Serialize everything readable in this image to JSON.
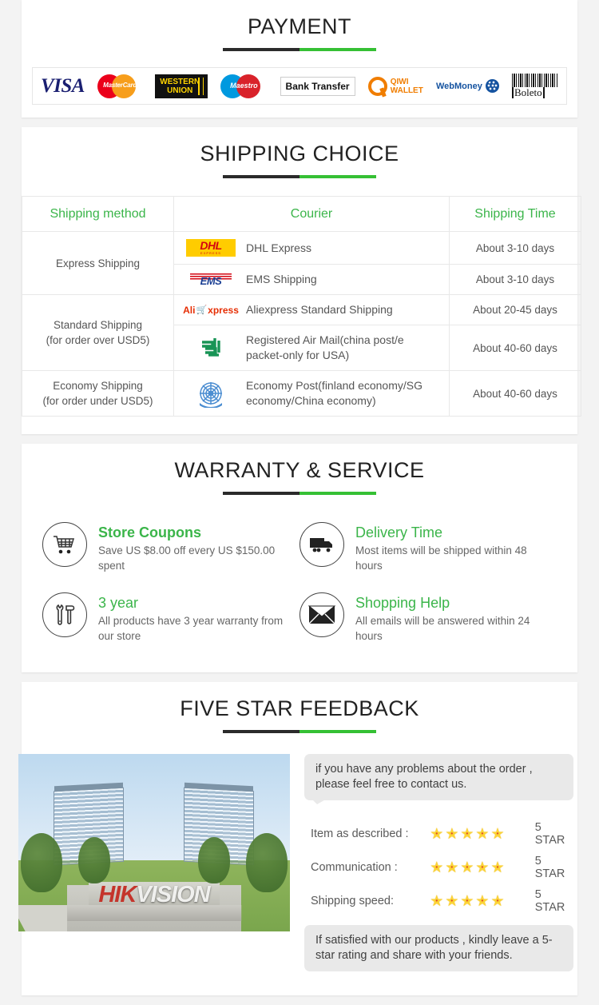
{
  "theme": {
    "accent_green": "#3bb54a",
    "rule_dark": "#2b2b2b",
    "rule_green": "#35c034",
    "page_bg": "#f3f3f3"
  },
  "payment": {
    "title": "PAYMENT",
    "logos": [
      {
        "name": "visa-logo",
        "text": "VISA"
      },
      {
        "name": "mastercard-logo",
        "text": "MasterCard"
      },
      {
        "name": "western-union-logo",
        "line1": "WESTERN",
        "line2": "UNION"
      },
      {
        "name": "maestro-logo",
        "text": "Maestro"
      },
      {
        "name": "bank-transfer-logo",
        "text": "Bank Transfer"
      },
      {
        "name": "qiwi-wallet-logo",
        "line1": "QIWI",
        "line2": "WALLET"
      },
      {
        "name": "webmoney-logo",
        "text": "WebMoney"
      },
      {
        "name": "boleto-logo",
        "text": "Boleto"
      }
    ]
  },
  "shipping": {
    "title": "SHIPPING CHOICE",
    "columns": [
      "Shipping method",
      "Courier",
      "Shipping Time"
    ],
    "rows": [
      {
        "method": "Express Shipping",
        "method_line2": "",
        "courier": "DHL Express",
        "logo": "dhl-logo",
        "time": "About 3-10 days"
      },
      {
        "method": "",
        "method_line2": "",
        "courier": "EMS Shipping",
        "logo": "ems-logo",
        "time": "About 3-10 days"
      },
      {
        "method": "Standard Shipping",
        "method_line2": "(for order over USD5)",
        "courier": "Aliexpress Standard Shipping",
        "logo": "aliexpress-logo",
        "time": "About 20-45 days"
      },
      {
        "method": "",
        "method_line2": "",
        "courier": "Registered Air Mail(china post/e packet-only for USA)",
        "logo": "china-post-logo",
        "time": "About 40-60 days"
      },
      {
        "method": "Economy Shipping",
        "method_line2": "(for order under USD5)",
        "courier": "Economy Post(finland economy/SG economy/China economy)",
        "logo": "un-post-logo",
        "time": "About 40-60 days"
      }
    ]
  },
  "warranty": {
    "title": "WARRANTY & SERVICE",
    "items": [
      {
        "icon": "shopping-cart-icon",
        "title": "Store Coupons",
        "desc": "Save US $8.00 off every US $150.00 spent"
      },
      {
        "icon": "delivery-truck-icon",
        "title": "Delivery Time",
        "desc": "Most items will be shipped within 48 hours"
      },
      {
        "icon": "tools-icon",
        "title": "3 year",
        "desc": "All products have 3 year warranty from our store"
      },
      {
        "icon": "envelope-icon",
        "title": "Shopping Help",
        "desc": "All emails will be answered within 24 hours"
      }
    ]
  },
  "feedback": {
    "title": "FIVE STAR FEEDBACK",
    "photo": {
      "name": "hikvision-headquarters-photo",
      "sign_red": "HIK",
      "sign_white": "VISION"
    },
    "bubble_top": "if you have any problems about the order , please feel free to contact us.",
    "ratings": [
      {
        "label": "Item as described :",
        "stars": 5,
        "value": "5 STAR"
      },
      {
        "label": "Communication :",
        "stars": 5,
        "value": "5 STAR"
      },
      {
        "label": "Shipping speed:",
        "stars": 5,
        "value": "5 STAR"
      }
    ],
    "bubble_bottom": "If satisfied with our products , kindly leave a 5-star rating and share with your friends."
  }
}
